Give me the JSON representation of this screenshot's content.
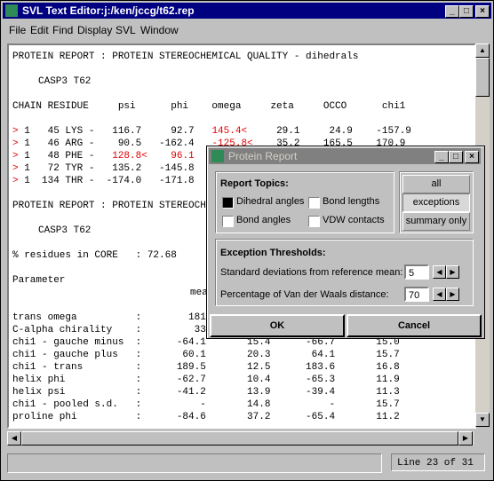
{
  "window": {
    "title": "SVL Text Editor:j:/ken/jccg/t62.rep"
  },
  "menu": [
    "File",
    "Edit",
    "Find",
    "Display",
    "SVL",
    "Window"
  ],
  "report": {
    "heading1": "PROTEIN REPORT : PROTEIN STEREOCHEMICAL QUALITY - dihedrals",
    "subtitle1": "CASP3 T62",
    "columns": "CHAIN RESIDUE     psi      phi    omega     zeta     OCCO      chi1",
    "rows": [
      {
        "marker": ">",
        "a": " 1   45 LYS -   116.7     92.7   ",
        "b": "145.4<",
        "c": "     29.1     24.9    -157.9"
      },
      {
        "marker": ">",
        "a": " 1   46 ARG -    90.5   -162.4   ",
        "b": "-125.8<",
        "c": "    35.2    165.5    170.9"
      },
      {
        "marker": ">",
        "a": " 1   48 PHE -   ",
        "b": "128.8<",
        "c": "    96.1"
      },
      {
        "marker": ">",
        "a": " 1   72 TYR -   135.2   -145.8",
        "b": "",
        "c": ""
      },
      {
        "marker": ">",
        "a": " 1  134 THR -  -174.0   -171.8",
        "b": "",
        "c": ""
      }
    ],
    "heading2": "PROTEIN REPORT : PROTEIN STEREOCHEMICAL QUALITY",
    "subtitle2": "CASP3 T62",
    "core_line": "% residues in CORE   : 72.68",
    "param_header": "Parameter",
    "mean_header": "mean",
    "params": [
      "trans omega          :        181",
      "C-alpha chirality    :         33",
      "chi1 - gauche minus  :      -64.1       15.4      -66.7       15.0",
      "chi1 - gauche plus   :       60.1       20.3       64.1       15.7",
      "chi1 - trans         :      189.5       12.5      183.6       16.8",
      "helix phi            :      -62.7       10.4      -65.3       11.9",
      "helix psi            :      -41.2       13.9      -39.4       11.3",
      "chi1 - pooled s.d.   :          -       14.8          -       15.7",
      "proline phi          :      -84.6       37.2      -65.4       11.2"
    ]
  },
  "status": {
    "position": "Line 23 of 31"
  },
  "dialog": {
    "title": "Protein Report",
    "topics_label": "Report Topics:",
    "topics": {
      "dihedral": "Dihedral angles",
      "bond_lengths": "Bond lengths",
      "bond_angles": "Bond angles",
      "vdw": "VDW contacts"
    },
    "modes": {
      "all": "all",
      "exceptions": "exceptions",
      "summary": "summary only"
    },
    "thresholds_label": "Exception Thresholds:",
    "std_label": "Standard deviations from reference mean:",
    "std_value": "5",
    "vdw_label": "Percentage of Van der Waals distance:",
    "vdw_value": "70",
    "ok": "OK",
    "cancel": "Cancel"
  }
}
